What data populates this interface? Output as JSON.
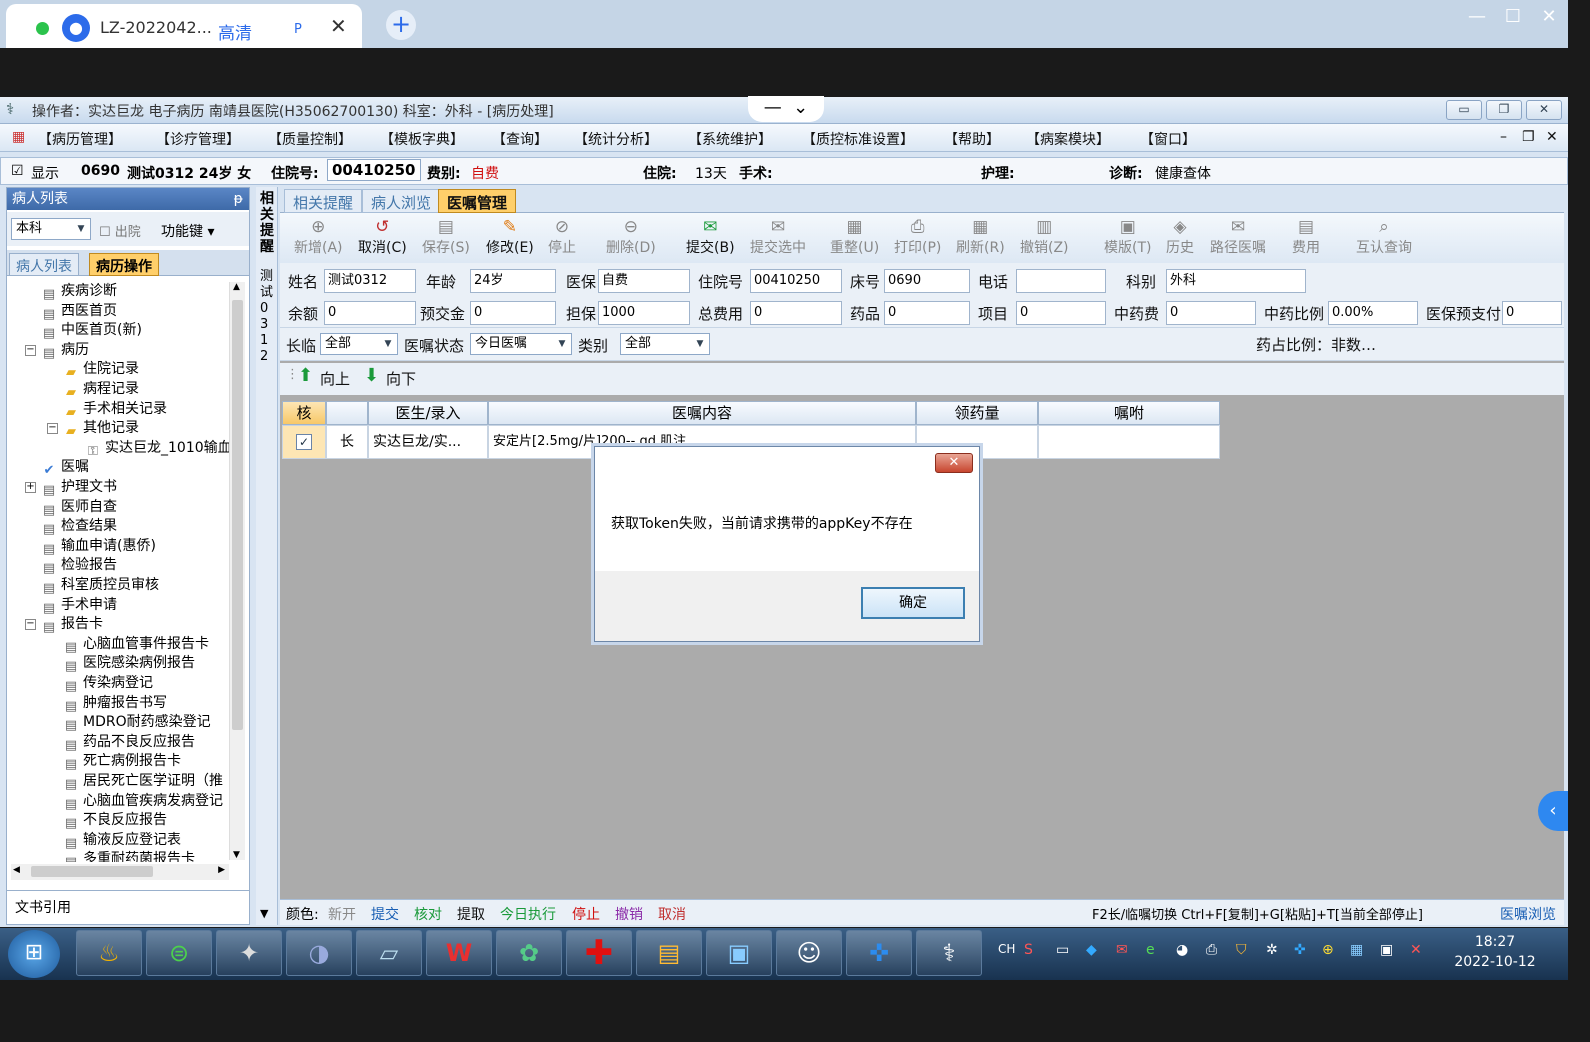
{
  "browser": {
    "tab_title": "LZ-2022042...",
    "tab_hd": "高清",
    "tab_p": "P",
    "win_min": "—",
    "win_max": "☐",
    "win_close": "✕",
    "newtab": "+"
  },
  "app": {
    "title": "操作者：实达巨龙 电子病历  南靖县医院(H35062700130)  科室：外科 - [病历处理]",
    "center_min": "—",
    "center_chevron": "⌄"
  },
  "menu": [
    "【病历管理】",
    "【诊疗管理】",
    "【质量控制】",
    "【模板字典】",
    "【查询】",
    "【统计分析】",
    "【系统维护】",
    "【质控标准设置】",
    "【帮助】",
    "【病案模块】",
    "【窗口】"
  ],
  "infobar": {
    "show": "显示",
    "bed": "0690",
    "patient": "测试0312 24岁 女",
    "admit_label": "住院号:",
    "admit_no": "00410250",
    "fee_label": "费别:",
    "fee": "自费",
    "stay_label": "住院:",
    "stay": "13天",
    "surgery_label": "手术:",
    "nursing_label": "护理:",
    "diag_label": "诊断:",
    "diag": "健康查体"
  },
  "left": {
    "header": "病人列表",
    "pin": "ᵽ",
    "dept": "本科",
    "discharge": "出院",
    "funckey": "功能键",
    "tab1": "病人列表",
    "tab2": "病历操作",
    "footer": "文书引用"
  },
  "tree": [
    {
      "label": "疾病诊断",
      "indent": 1
    },
    {
      "label": "西医首页",
      "indent": 1
    },
    {
      "label": "中医首页(新)",
      "indent": 1
    },
    {
      "label": "病历",
      "indent": 1
    },
    {
      "label": "住院记录",
      "indent": 2
    },
    {
      "label": "病程记录",
      "indent": 2
    },
    {
      "label": "手术相关记录",
      "indent": 2
    },
    {
      "label": "其他记录",
      "indent": 2
    },
    {
      "label": "实达巨龙_1010输血",
      "indent": 3
    },
    {
      "label": "医嘱",
      "indent": 1
    },
    {
      "label": "护理文书",
      "indent": 1
    },
    {
      "label": "医师自查",
      "indent": 1
    },
    {
      "label": "检查结果",
      "indent": 1
    },
    {
      "label": "输血申请(惠侨)",
      "indent": 1
    },
    {
      "label": "检验报告",
      "indent": 1
    },
    {
      "label": "科室质控员审核",
      "indent": 1
    },
    {
      "label": "手术申请",
      "indent": 1
    },
    {
      "label": "报告卡",
      "indent": 1
    },
    {
      "label": "心脑血管事件报告卡",
      "indent": 2
    },
    {
      "label": "医院感染病例报告",
      "indent": 2
    },
    {
      "label": "传染病登记",
      "indent": 2
    },
    {
      "label": "肿瘤报告书写",
      "indent": 2
    },
    {
      "label": "MDRO耐药感染登记",
      "indent": 2
    },
    {
      "label": "药品不良反应报告",
      "indent": 2
    },
    {
      "label": "死亡病例报告卡",
      "indent": 2
    },
    {
      "label": "居民死亡医学证明（推",
      "indent": 2
    },
    {
      "label": "心脑血管疾病发病登记",
      "indent": 2
    },
    {
      "label": "不良反应报告",
      "indent": 2
    },
    {
      "label": "输液反应登记表",
      "indent": 2
    },
    {
      "label": "多重耐药菌报告卡",
      "indent": 2
    }
  ],
  "vstrip": {
    "top": "相关提醒",
    "bottom": "测试0312"
  },
  "tabs": [
    "相关提醒",
    "病人浏览",
    "医嘱管理"
  ],
  "toolbar": [
    {
      "label": "新增(A)",
      "icon": "⊕",
      "on": false
    },
    {
      "label": "取消(C)",
      "icon": "↺",
      "on": true
    },
    {
      "label": "保存(S)",
      "icon": "▤",
      "on": false
    },
    {
      "label": "修改(E)",
      "icon": "✎",
      "on": true
    },
    {
      "label": "停止",
      "icon": "⊘",
      "on": false
    },
    {
      "label": "删除(D)",
      "icon": "⊖",
      "on": false
    },
    {
      "label": "提交(B)",
      "icon": "✉",
      "on": true
    },
    {
      "label": "提交选中",
      "icon": "✉",
      "on": false
    },
    {
      "label": "重整(U)",
      "icon": "▦",
      "on": false
    },
    {
      "label": "打印(P)",
      "icon": "⎙",
      "on": false
    },
    {
      "label": "刷新(R)",
      "icon": "▦",
      "on": false
    },
    {
      "label": "撤销(Z)",
      "icon": "▥",
      "on": false
    },
    {
      "label": "模版(T)",
      "icon": "▣",
      "on": false
    },
    {
      "label": "历史",
      "icon": "◈",
      "on": false
    },
    {
      "label": "路径医嘱",
      "icon": "✉",
      "on": false
    },
    {
      "label": "费用",
      "icon": "▤",
      "on": false
    },
    {
      "label": "互认查询",
      "icon": "⌕",
      "on": false
    }
  ],
  "form": {
    "name_l": "姓名",
    "name": "测试0312",
    "age_l": "年龄",
    "age": "24岁",
    "ins_l": "医保",
    "ins": "自费",
    "admit_l": "住院号",
    "admit": "00410250",
    "bed_l": "床号",
    "bed": "0690",
    "tel_l": "电话",
    "tel": "",
    "dept_l": "科别",
    "dept": "外科",
    "bal_l": "余额",
    "bal": "0",
    "pre_l": "预交金",
    "pre": "0",
    "guar_l": "担保",
    "guar": "1000",
    "total_l": "总费用",
    "total": "0",
    "drug_l": "药品",
    "drug": "0",
    "item_l": "项目",
    "item": "0",
    "tcm_l": "中药费",
    "tcm": "0",
    "tcmr_l": "中药比例",
    "tcmr": "0.00%",
    "ins_pre_l": "医保预支付",
    "ins_pre": "0"
  },
  "filter": {
    "long_l": "长临",
    "long": "全部",
    "state_l": "医嘱状态",
    "state": "今日医嘱",
    "cat_l": "类别",
    "cat": "全部",
    "ratio": "药占比例：非数…"
  },
  "nav": {
    "up": "向上",
    "down": "向下"
  },
  "grid": {
    "headers": [
      "核",
      "",
      "医生/录入",
      "医嘱内容",
      "领药量",
      "嘱咐"
    ],
    "row": {
      "check": "✓",
      "type": "长",
      "doctor": "实达巨龙/实...",
      "content": "安定片[2.5mg/片]200-- gd 肌注",
      "qty": "",
      "note": ""
    }
  },
  "status": {
    "color_l": "颜色:",
    "items": [
      {
        "t": "新开",
        "c": "#888888"
      },
      {
        "t": "提交",
        "c": "#1a5fb4"
      },
      {
        "t": "核对",
        "c": "#1a9a3a"
      },
      {
        "t": "提取",
        "c": "#111111"
      },
      {
        "t": "今日执行",
        "c": "#1a9a3a"
      },
      {
        "t": "停止",
        "c": "#d01010"
      },
      {
        "t": "撤销",
        "c": "#8a2aa8"
      },
      {
        "t": "取消",
        "c": "#c03030"
      }
    ],
    "hint": "F2长/临嘱切换 Ctrl+F[复制]+G[粘贴]+T[当前全部停止]",
    "browse": "医嘱浏览"
  },
  "dialog": {
    "message": "获取Token失败，当前请求携带的appKey不存在",
    "ok": "确定",
    "close": "✕"
  },
  "taskbar": {
    "time": "18:27",
    "date": "2022-10-12",
    "ime": "CH"
  }
}
